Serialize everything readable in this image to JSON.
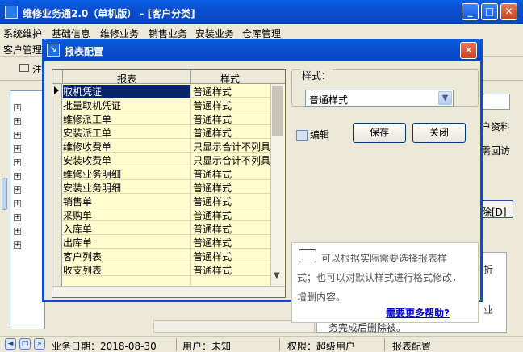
{
  "main": {
    "title": "维修业务通2.0（单机版） - [客户分类]",
    "menu": [
      "系统维护",
      "基础信息",
      "维修业务",
      "销售业务",
      "安装业务",
      "仓库管理"
    ],
    "sub_label": "客户管理",
    "toolbar_btn": "注",
    "right_texts": [
      "户资料",
      "需回访",
      "除[D]",
      "折",
      "业",
      "务完成后删除被。"
    ]
  },
  "status": {
    "date": "业务日期：2018-08-30",
    "user": "用户：未知",
    "perm": "权限：超级用户",
    "current": "报表配置"
  },
  "dialog": {
    "title": "报表配置",
    "col_report": "报表",
    "col_style": "样式",
    "rows": [
      {
        "report": "取机凭证",
        "style": "普通样式"
      },
      {
        "report": "批量取机凭证",
        "style": "普通样式"
      },
      {
        "report": "维修派工单",
        "style": "普通样式"
      },
      {
        "report": "安装派工单",
        "style": "普通样式"
      },
      {
        "report": "维修收费单",
        "style": "只显示合计不列具"
      },
      {
        "report": "安装收费单",
        "style": "只显示合计不列具"
      },
      {
        "report": "维修业务明细",
        "style": "普通样式"
      },
      {
        "report": "安装业务明细",
        "style": "普通样式"
      },
      {
        "report": "销售单",
        "style": "普通样式"
      },
      {
        "report": "采购单",
        "style": "普通样式"
      },
      {
        "report": "入库单",
        "style": "普通样式"
      },
      {
        "report": "出库单",
        "style": "普通样式"
      },
      {
        "report": "客户列表",
        "style": "普通样式"
      },
      {
        "report": "收支列表",
        "style": "普通样式"
      }
    ],
    "style_label": "样式：",
    "style_value": "普通样式",
    "edit_label": "编辑",
    "save_label": "保存",
    "close_label": "关闭",
    "help_line1": "可以根据实际需要选择报表样",
    "help_line2": "式；也可以对默认样式进行格式修改，",
    "help_line3": "增删内容。",
    "help_link": "需要更多帮助?"
  }
}
